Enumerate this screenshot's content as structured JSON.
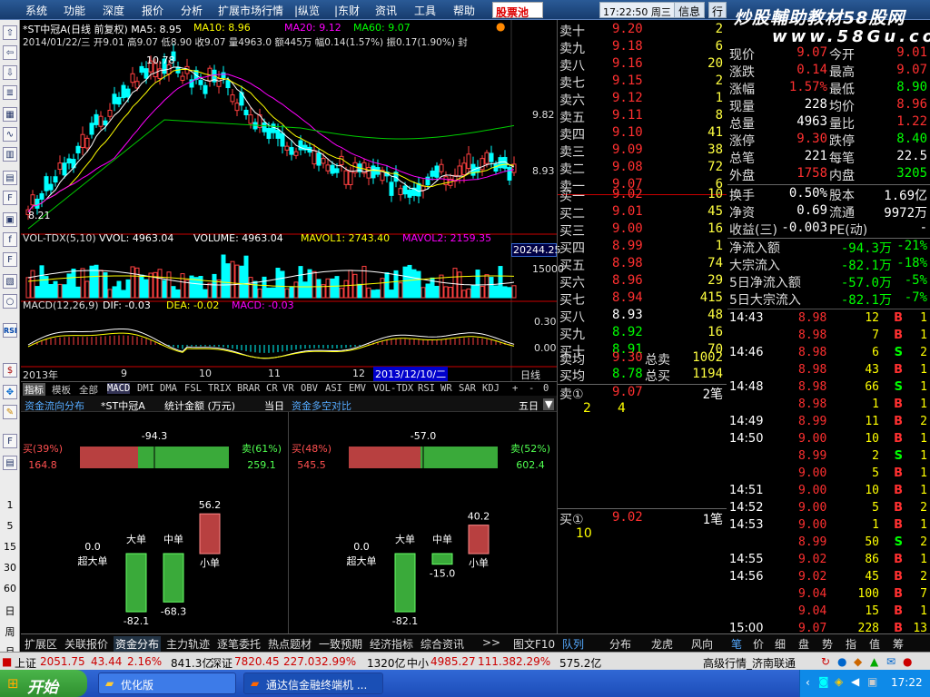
{
  "menu": [
    "系统",
    "功能",
    "深度",
    "报价",
    "分析",
    "扩展市场行情",
    "|纵览",
    "|东财",
    "资讯",
    "工具",
    "帮助"
  ],
  "pool_label": "股票池",
  "clock": "17:22:50 周三",
  "info_btn": "信息",
  "row_btn": "行",
  "brand": "炒股輔助教材58股网",
  "brand_url": "www.58Gu.com",
  "toolbar_numbers": [
    "1",
    "5",
    "15",
    "30",
    "60",
    "日",
    "周",
    "月"
  ],
  "chart": {
    "title": "*ST中冠A(日线 前复权) MA5: 8.95",
    "ma10": "MA10: 8.96",
    "ma20": "MA20: 9.12",
    "ma60": "MA60: 9.07",
    "info_line": "2014/01/22/三 开9.01 高9.07 低8.90 收9.07 量4963.0 额445万 幅0.14(1.57%) 振0.17(1.90%) 封",
    "high_label": "10.78",
    "low_label": "8.21",
    "axis_main": [
      "9.82",
      "8.93"
    ],
    "vol_label": "VOL-TDX(5,10)",
    "vvol": "VVOL: 4963.04",
    "volume": "VOLUME: 4963.04",
    "mavol1": "MAVOL1: 2743.40",
    "mavol2": "MAVOL2: 2159.35",
    "vol_box": "20244.25",
    "vol_axis": "15000",
    "macd_label": "MACD(12,26,9)",
    "dif": "DIF: -0.03",
    "dea": "DEA: -0.02",
    "macd_val": "MACD: -0.03",
    "macd_axis": [
      "0.30",
      "0.00"
    ],
    "date_axis": [
      "2013年",
      "9",
      "10",
      "11",
      "12"
    ],
    "date_box": "2013/12/10/二",
    "period": "日线"
  },
  "indicator_tabs": [
    "指标",
    "模板",
    "全部",
    "MACD",
    "DMI",
    "DMA",
    "FSL",
    "TRIX",
    "BRAR",
    "CR",
    "VR",
    "OBV",
    "ASI",
    "EMV",
    "VOL-TDX",
    "RSI",
    "WR",
    "SAR",
    "KDJ",
    "+",
    "-",
    "0"
  ],
  "fund": {
    "left_title": "资金流向分布",
    "stock": "*ST中冠A",
    "unit": "统计金额 (万元)",
    "period_today": "当日",
    "right_title": "资金多空对比",
    "period_5": "五日",
    "left": {
      "net": "-94.3",
      "buy_label": "买(39%)",
      "buy_val": "164.8",
      "sell_label": "卖(61%)",
      "sell_val": "259.1",
      "buy_pct": 0.39,
      "bars": [
        {
          "name": "超大单",
          "val": "0.0",
          "v": 0.0
        },
        {
          "name": "大单",
          "val": "-82.1",
          "v": -82.1
        },
        {
          "name": "中单",
          "val": "-68.3",
          "v": -68.3
        },
        {
          "name": "小单",
          "val": "56.2",
          "v": 56.2
        }
      ]
    },
    "right": {
      "net": "-57.0",
      "buy_label": "买(48%)",
      "buy_val": "545.5",
      "sell_label": "卖(52%)",
      "sell_val": "602.4",
      "buy_pct": 0.48,
      "bars": [
        {
          "name": "超大单",
          "val": "0.0",
          "v": 0.0
        },
        {
          "name": "大单",
          "val": "-82.1",
          "v": -82.1
        },
        {
          "name": "中单",
          "val": "-15.0",
          "v": -15.0
        },
        {
          "name": "小单",
          "val": "40.2",
          "v": 40.2
        }
      ]
    }
  },
  "bottom_tabs": [
    "扩展区",
    "关联报价",
    "资金分布",
    "主力轨迹",
    "逐笔委托",
    "热点题材",
    "一致预期",
    "经济指标",
    "综合资讯",
    ">>",
    "图文F10"
  ],
  "quote": {
    "sells": [
      {
        "l": "卖十",
        "p": "9.20",
        "v": "2"
      },
      {
        "l": "卖九",
        "p": "9.18",
        "v": "6"
      },
      {
        "l": "卖八",
        "p": "9.16",
        "v": "20"
      },
      {
        "l": "卖七",
        "p": "9.15",
        "v": "2"
      },
      {
        "l": "卖六",
        "p": "9.12",
        "v": "1"
      },
      {
        "l": "卖五",
        "p": "9.11",
        "v": "8"
      },
      {
        "l": "卖四",
        "p": "9.10",
        "v": "41"
      },
      {
        "l": "卖三",
        "p": "9.09",
        "v": "38"
      },
      {
        "l": "卖二",
        "p": "9.08",
        "v": "72"
      },
      {
        "l": "卖一",
        "p": "9.07",
        "v": "6"
      }
    ],
    "buys": [
      {
        "l": "买一",
        "p": "9.02",
        "v": "10"
      },
      {
        "l": "买二",
        "p": "9.01",
        "v": "45"
      },
      {
        "l": "买三",
        "p": "9.00",
        "v": "16"
      },
      {
        "l": "买四",
        "p": "8.99",
        "v": "1"
      },
      {
        "l": "买五",
        "p": "8.98",
        "v": "74"
      },
      {
        "l": "买六",
        "p": "8.96",
        "v": "29"
      },
      {
        "l": "买七",
        "p": "8.94",
        "v": "415"
      },
      {
        "l": "买八",
        "p": "8.93",
        "v": "48"
      },
      {
        "l": "买九",
        "p": "8.92",
        "v": "16"
      },
      {
        "l": "买十",
        "p": "8.91",
        "v": "70"
      }
    ],
    "avg_sell_l": "卖均",
    "avg_sell_p": "9.30",
    "tot_sell_l": "总卖",
    "tot_sell_v": "1002",
    "avg_buy_l": "买均",
    "avg_buy_p": "8.78",
    "tot_buy_l": "总买",
    "tot_buy_v": "1194",
    "sell1_q": "卖①",
    "sell1_p": "9.07",
    "sell1_n": "2笔",
    "sell1_a": "2",
    "sell1_b": "4",
    "buy1_q": "买①",
    "buy1_p": "9.02",
    "buy1_n": "1笔",
    "buy1_a": "10"
  },
  "stats": [
    {
      "a": "现价",
      "av": "9.07",
      "b": "今开",
      "bv": "9.01"
    },
    {
      "a": "涨跌",
      "av": "0.14",
      "b": "最高",
      "bv": "9.07"
    },
    {
      "a": "涨幅",
      "av": "1.57%",
      "b": "最低",
      "bv": "8.90"
    },
    {
      "a": "现量",
      "av": "228",
      "b": "均价",
      "bv": "8.96"
    },
    {
      "a": "总量",
      "av": "4963",
      "b": "量比",
      "bv": "1.22"
    },
    {
      "a": "涨停",
      "av": "9.30",
      "b": "跌停",
      "bv": "8.40"
    },
    {
      "a": "总笔",
      "av": "221",
      "b": "每笔",
      "bv": "22.5"
    },
    {
      "a": "外盘",
      "av": "1758",
      "b": "内盘",
      "bv": "3205"
    }
  ],
  "stats2": [
    {
      "a": "换手",
      "av": "0.50%",
      "b": "股本",
      "bv": "1.69亿"
    },
    {
      "a": "净资",
      "av": "0.69",
      "b": "流通",
      "bv": "9972万"
    },
    {
      "a": "收益(三)",
      "av": "-0.003",
      "b": "PE(动)",
      "bv": "-"
    }
  ],
  "flows": [
    {
      "a": "净流入额",
      "av": "-94.3万",
      "bv": "-21%"
    },
    {
      "a": "大宗流入",
      "av": "-82.1万",
      "bv": "-18%"
    },
    {
      "a": "5日净流入额",
      "av": "-57.0万",
      "bv": "-5%"
    },
    {
      "a": "5日大宗流入",
      "av": "-82.1万",
      "bv": "-7%"
    }
  ],
  "trades": [
    {
      "t": "14:43",
      "p": "8.98",
      "v": "12",
      "d": "B",
      "n": "1"
    },
    {
      "t": "",
      "p": "8.98",
      "v": "7",
      "d": "B",
      "n": "1"
    },
    {
      "t": "14:46",
      "p": "8.98",
      "v": "6",
      "d": "S",
      "n": "2"
    },
    {
      "t": "",
      "p": "8.98",
      "v": "43",
      "d": "B",
      "n": "1"
    },
    {
      "t": "14:48",
      "p": "8.98",
      "v": "66",
      "d": "S",
      "n": "1"
    },
    {
      "t": "",
      "p": "8.98",
      "v": "1",
      "d": "B",
      "n": "1"
    },
    {
      "t": "14:49",
      "p": "8.99",
      "v": "11",
      "d": "B",
      "n": "2"
    },
    {
      "t": "14:50",
      "p": "9.00",
      "v": "10",
      "d": "B",
      "n": "1"
    },
    {
      "t": "",
      "p": "8.99",
      "v": "2",
      "d": "S",
      "n": "1"
    },
    {
      "t": "",
      "p": "9.00",
      "v": "5",
      "d": "B",
      "n": "1"
    },
    {
      "t": "14:51",
      "p": "9.00",
      "v": "10",
      "d": "B",
      "n": "1"
    },
    {
      "t": "14:52",
      "p": "9.00",
      "v": "5",
      "d": "B",
      "n": "2"
    },
    {
      "t": "14:53",
      "p": "9.00",
      "v": "1",
      "d": "B",
      "n": "1"
    },
    {
      "t": "",
      "p": "8.99",
      "v": "50",
      "d": "S",
      "n": "2"
    },
    {
      "t": "14:55",
      "p": "9.02",
      "v": "86",
      "d": "B",
      "n": "1"
    },
    {
      "t": "14:56",
      "p": "9.02",
      "v": "45",
      "d": "B",
      "n": "2"
    },
    {
      "t": "",
      "p": "9.04",
      "v": "100",
      "d": "B",
      "n": "7"
    },
    {
      "t": "",
      "p": "9.04",
      "v": "15",
      "d": "B",
      "n": "1"
    },
    {
      "t": "15:00",
      "p": "9.07",
      "v": "228",
      "d": "B",
      "n": "13"
    }
  ],
  "right_tabs": [
    "队列",
    "分布",
    "龙虎",
    "风向",
    "笔",
    "价",
    "细",
    "盘",
    "势",
    "指",
    "值",
    "筹"
  ],
  "ticker": {
    "sh_l": "上证",
    "sh_v": "2051.75",
    "sh_c": "43.44",
    "sh_p": "2.16%",
    "sh_a": "841.3亿",
    "sz_l": "深证",
    "sz_v": "7820.45",
    "sz_c": "227.03",
    "sz_p": "2.99%",
    "sz_a": "1320亿",
    "zx_l": "中小",
    "zx_v": "4985.27",
    "zx_c": "111.38",
    "zx_p": "2.29%",
    "zx_a": "575.2亿",
    "level": "高级行情_济南联通"
  },
  "taskbar": {
    "start": "开始",
    "task1": "优化版",
    "task2": "通达信金融终端机 ...",
    "time": "17:22"
  }
}
